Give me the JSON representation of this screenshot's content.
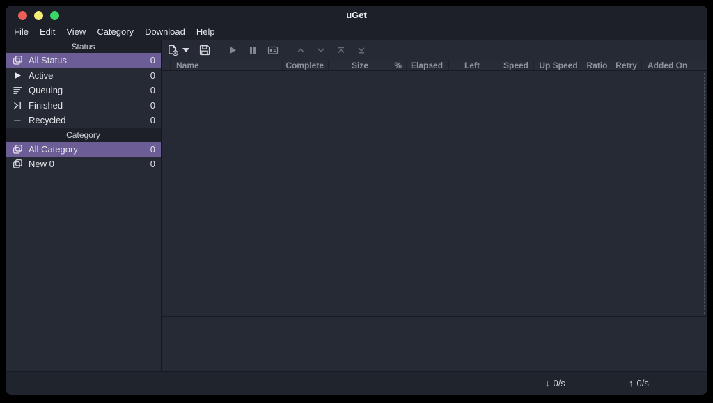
{
  "window": {
    "title": "uGet"
  },
  "menu": {
    "items": [
      "File",
      "Edit",
      "View",
      "Category",
      "Download",
      "Help"
    ]
  },
  "sidebar": {
    "status_header": "Status",
    "status_items": [
      {
        "label": "All Status",
        "count": "0",
        "icon": "stack-icon",
        "selected": true
      },
      {
        "label": "Active",
        "count": "0",
        "icon": "play-icon",
        "selected": false
      },
      {
        "label": "Queuing",
        "count": "0",
        "icon": "queue-lines-icon",
        "selected": false
      },
      {
        "label": "Finished",
        "count": "0",
        "icon": "skip-to-end-icon",
        "selected": false
      },
      {
        "label": "Recycled",
        "count": "0",
        "icon": "minus-icon",
        "selected": false
      }
    ],
    "category_header": "Category",
    "category_items": [
      {
        "label": "All Category",
        "count": "0",
        "icon": "stack-icon",
        "selected": true
      },
      {
        "label": "New 0",
        "count": "0",
        "icon": "stack-icon",
        "selected": false
      }
    ]
  },
  "toolbar": {
    "buttons": [
      {
        "icon": "new-download-icon",
        "enabled": true
      },
      {
        "icon": "new-dropdown-caret-icon",
        "enabled": true
      },
      {
        "icon": "save-icon",
        "enabled": true
      },
      {
        "icon": "start-icon",
        "enabled": false
      },
      {
        "icon": "pause-icon",
        "enabled": false
      },
      {
        "icon": "properties-icon",
        "enabled": false
      },
      {
        "icon": "move-up-icon",
        "enabled": false
      },
      {
        "icon": "move-down-icon",
        "enabled": false
      },
      {
        "icon": "move-top-icon",
        "enabled": false
      },
      {
        "icon": "move-bottom-icon",
        "enabled": false
      }
    ]
  },
  "table": {
    "columns": [
      "",
      "Name",
      "Complete",
      "Size",
      "%",
      "Elapsed",
      "Left",
      "Speed",
      "Up Speed",
      "Ratio",
      "Retry",
      "Added On"
    ],
    "rows": []
  },
  "statusbar": {
    "down_arrow": "↓",
    "down_speed": "0/s",
    "up_arrow": "↑",
    "up_speed": "0/s"
  },
  "colors": {
    "accent": "#6c5d96",
    "close-color": "#ec5f57",
    "minimize-color": "#f3ef76",
    "maximize-color": "#3bd568"
  }
}
